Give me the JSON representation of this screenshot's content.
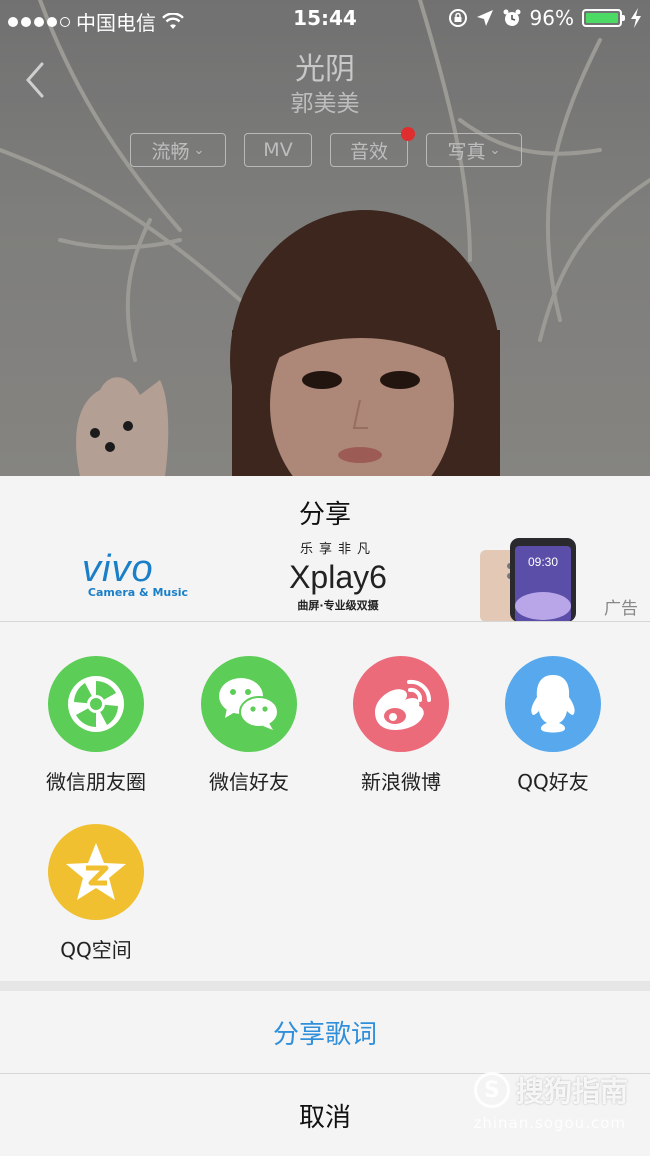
{
  "status_bar": {
    "carrier": "中国电信",
    "time": "15:44",
    "battery": "96%",
    "signal_bars": 4,
    "battery_level": 0.96
  },
  "player": {
    "song_title": "光阴",
    "artist": "郭美美",
    "options": [
      {
        "label": "流畅",
        "has_dropdown": true
      },
      {
        "label": "MV",
        "has_dropdown": false
      },
      {
        "label": "音效",
        "has_dropdown": false,
        "badge": true
      },
      {
        "label": "写真",
        "has_dropdown": true
      }
    ]
  },
  "share_sheet": {
    "title": "分享",
    "ad": {
      "brand": "vivo",
      "brand_tagline": "Camera & Music",
      "slogan": "乐享非凡",
      "product": "Xplay6",
      "product_sub": "曲屏·专业级双摄",
      "phone_time": "09:30",
      "tag": "广告"
    },
    "targets": [
      {
        "label": "微信朋友圈",
        "icon": "wechat-moments-icon",
        "color": "#5ccd56"
      },
      {
        "label": "微信好友",
        "icon": "wechat-icon",
        "color": "#5ccd56"
      },
      {
        "label": "新浪微博",
        "icon": "weibo-icon",
        "color": "#ec6b7b"
      },
      {
        "label": "QQ好友",
        "icon": "qq-icon",
        "color": "#57a8ec"
      },
      {
        "label": "QQ空间",
        "icon": "qzone-icon",
        "color": "#f0c031"
      }
    ],
    "share_lyrics": "分享歌词",
    "cancel": "取消"
  },
  "watermark": {
    "logo": "S",
    "name": "搜狗指南",
    "url": "zhinan.sogou.com"
  }
}
